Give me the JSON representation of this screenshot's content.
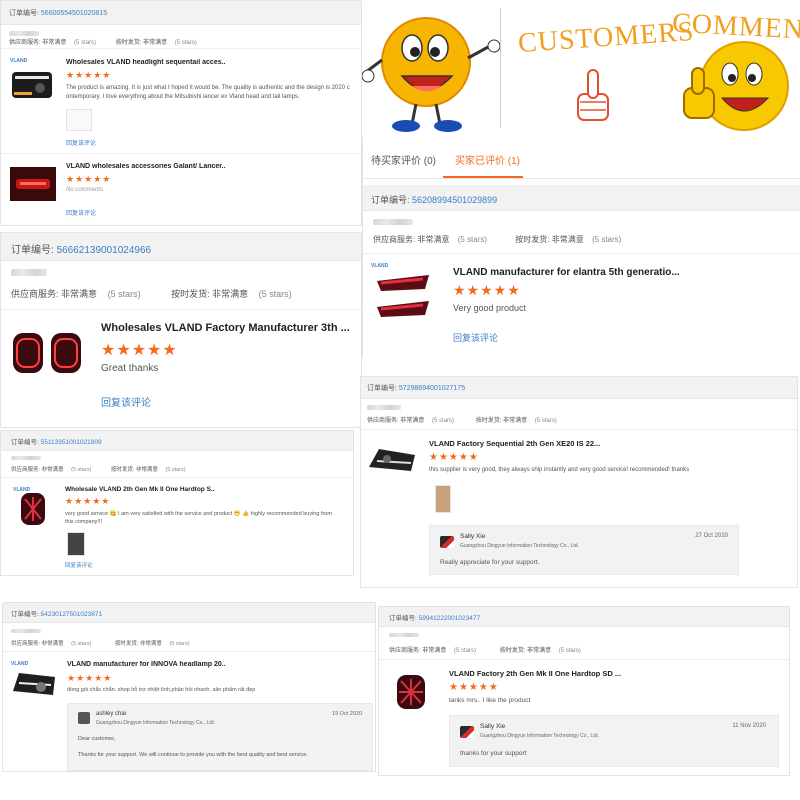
{
  "brand": {
    "accent": "#f26b1d",
    "link": "#3a7fc4",
    "star": "#f26b1d"
  },
  "banner": {
    "word1": "CUSTOMERS",
    "word2": "COMMENTS"
  },
  "tabs": {
    "pending": "待买家评价 (0)",
    "done": "买家已评价 (1)"
  },
  "common": {
    "order_label": "订单编号:",
    "supplier_label": "供应商服务:",
    "supplier_value": "非常满意",
    "shipping_label": "按时发货:",
    "shipping_value": "非常满意",
    "stars_note": "(5 stars)",
    "reply_link": "回复该评论",
    "stars": "★★★★★",
    "vland_tag": "VLAND"
  },
  "cards": {
    "c1": {
      "order_no": "56600554501020815",
      "items": [
        {
          "title": "Wholesales VLAND headlight sequentail acces..",
          "comment": "The product is amazing. It is just what I hoped it would be. The quality is authentic and the design is 2020 c ontemporary. I love everything about the Mitsubishi lancer ex Vland head and tail lamps."
        },
        {
          "title": "VLAND wholesales accessories Galant/ Lancer..",
          "comment": "No comments"
        }
      ]
    },
    "c2": {
      "order_no": "56208994501029899",
      "title": "VLAND manufacturer for elantra 5th generatio...",
      "comment": "Very good product"
    },
    "c3": {
      "order_no": "56662139001024966",
      "title": "Wholesales VLAND Factory Manufacturer 3th ...",
      "comment": "Great thanks"
    },
    "c4": {
      "order_no": "57298694001027175",
      "title": "VLAND Factory Sequential 2th Gen XE20 IS 22...",
      "comment": "this supplier is very good, they always ship instantly and very good service! recommended! thanks",
      "reply": {
        "name": "Sally Xie",
        "company": "Guangzhou Dingyun Information Technology Co., Ltd.",
        "date": "27 Oct 2020",
        "text": "Really appreciate for your support."
      }
    },
    "c5": {
      "order_no": "55113351001021809",
      "title": "Wholesale VLAND 2th Gen Mk II One Hardtop S..",
      "comment": "very good service 😋 I am very satisfied with the service and product 😁 👍 highly recommended buying from this company!!!"
    },
    "c6": {
      "order_no": "54230127501023871",
      "title": "VLAND manufacturer for INNOVA headlamp 20..",
      "comment": "đóng gói chắc chắn. shop hỗ trợ nhiệt tình,phản hồi nhanh. sản phẩm rất đẹp",
      "reply": {
        "name": "ashley chai",
        "company": "Guangzhou Dingyun Information Technology Co., Ltd.",
        "date": "19 Oct 2020",
        "line1": "Dear customer,",
        "line2": "Thanks for your support. We will continue to provide you with the best quality and best service."
      }
    },
    "c7": {
      "order_no": "59941222001023477",
      "title": "VLAND Factory 2th Gen Mk II One Hardtop SD ...",
      "comment": "tanks mrs.. I like the product",
      "reply": {
        "name": "Sally Xie",
        "company": "Guangzhou Dingyun Information Technology Co., Ltd.",
        "date": "11 Nov 2020",
        "text": "thanks for your support"
      }
    }
  }
}
